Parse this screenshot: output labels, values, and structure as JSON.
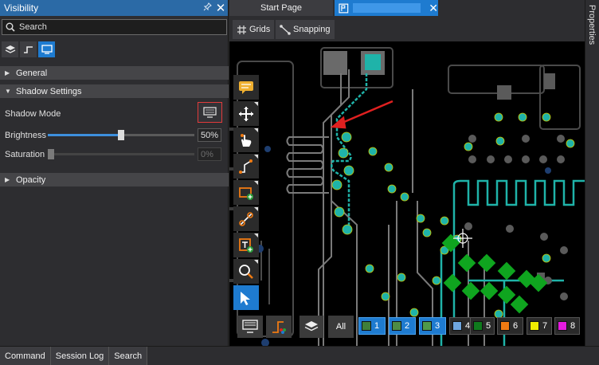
{
  "panel": {
    "title": "Visibility",
    "search_placeholder": "Search",
    "sections": {
      "general": "General",
      "shadow": "Shadow Settings",
      "opacity": "Opacity"
    },
    "shadow_mode_label": "Shadow Mode",
    "brightness": {
      "label": "Brightness",
      "value": "50%",
      "level": 0.5
    },
    "saturation": {
      "label": "Saturation",
      "value": "0%",
      "level": 0.0
    }
  },
  "doc_tabs": {
    "start": "Start Page"
  },
  "toolbar": {
    "grids": "Grids",
    "snapping": "Snapping"
  },
  "properties_label": "Properties",
  "layers": {
    "all": "All",
    "items": [
      {
        "num": "1",
        "color": "#3f7f3a"
      },
      {
        "num": "2",
        "color": "#4d8c45"
      },
      {
        "num": "3",
        "color": "#4f9a49"
      },
      {
        "num": "4",
        "color": "#6fa7e0"
      },
      {
        "num": "5",
        "color": "#0f7a1d"
      },
      {
        "num": "6",
        "color": "#f07a12"
      },
      {
        "num": "7",
        "color": "#f0ec00"
      },
      {
        "num": "8",
        "color": "#e61be0"
      }
    ]
  },
  "bottom_tabs": [
    "Command",
    "Session Log",
    "Search"
  ],
  "colors": {
    "accent": "#1e7bd0",
    "trace_teal": "#1fb3a9",
    "pad_green": "#0fa51f",
    "arrow_red": "#e02020"
  }
}
